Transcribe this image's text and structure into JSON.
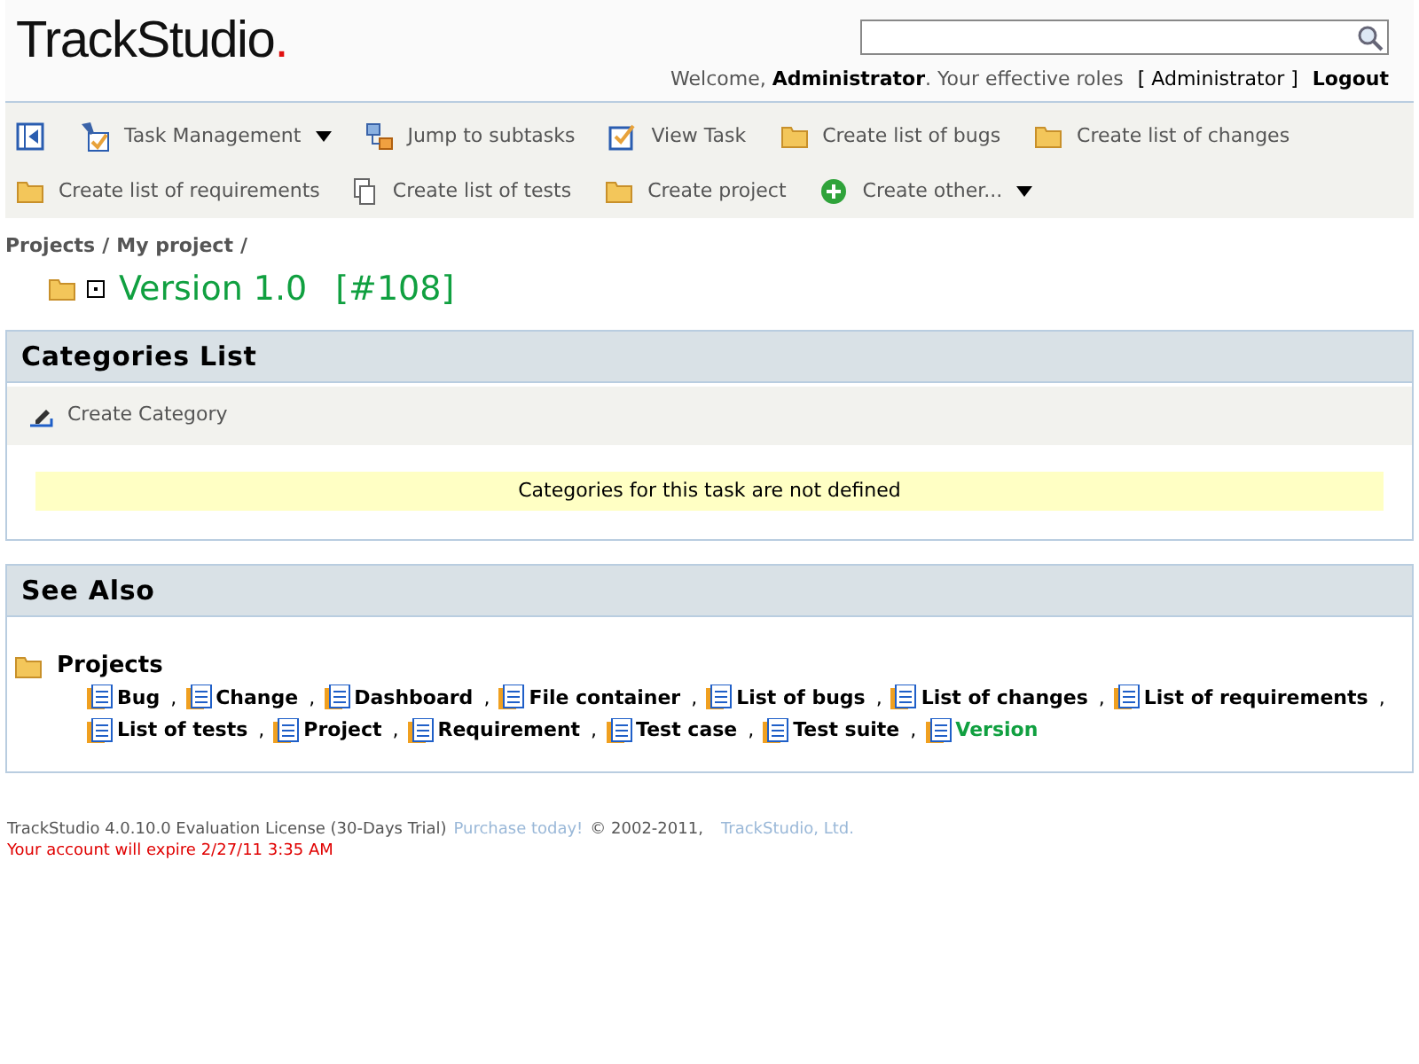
{
  "logo": {
    "text": "TrackStudio",
    "dot": "."
  },
  "user_bar": {
    "welcome": "Welcome,",
    "user": "Administrator",
    "roles_text": ". Your effective roles",
    "roles": "[ Administrator ]",
    "logout": "Logout"
  },
  "toolbar": [
    {
      "kind": "panel",
      "dropdown": false
    },
    {
      "kind": "tools",
      "label": "Task Management",
      "dropdown": true
    },
    {
      "kind": "subtasks",
      "label": "Jump to subtasks",
      "dropdown": false
    },
    {
      "kind": "check",
      "label": "View Task",
      "dropdown": false
    },
    {
      "kind": "folder",
      "label": "Create list of bugs",
      "dropdown": false
    },
    {
      "kind": "folder",
      "label": "Create list of changes",
      "dropdown": false
    },
    {
      "kind": "folder",
      "label": "Create list of requirements",
      "dropdown": false
    },
    {
      "kind": "copy",
      "label": "Create list of tests",
      "dropdown": false
    },
    {
      "kind": "folder",
      "label": "Create project",
      "dropdown": false
    },
    {
      "kind": "plus",
      "label": "Create other...",
      "dropdown": true
    }
  ],
  "breadcrumb": [
    {
      "label": "Projects",
      "sep": "/"
    },
    {
      "label": "My project",
      "sep": "/"
    }
  ],
  "task": {
    "title": "Version 1.0",
    "number": "[#108]"
  },
  "categories": {
    "title": "Categories List",
    "action": "Create Category",
    "notice": "Categories for this task are not defined"
  },
  "see_also": {
    "title": "See Also",
    "group": "Projects",
    "items": [
      {
        "label": "Bug",
        "suffix": ",",
        "current": false
      },
      {
        "label": "Change",
        "suffix": ",",
        "current": false
      },
      {
        "label": "Dashboard",
        "suffix": ",",
        "current": false
      },
      {
        "label": "File container",
        "suffix": ",",
        "current": false
      },
      {
        "label": "List of bugs",
        "suffix": ",",
        "current": false
      },
      {
        "label": "List of changes",
        "suffix": ",",
        "current": false
      },
      {
        "label": "List of requirements",
        "suffix": ",",
        "current": false
      },
      {
        "label": "List of tests",
        "suffix": ",",
        "current": false
      },
      {
        "label": "Project",
        "suffix": ",",
        "current": false
      },
      {
        "label": "Requirement",
        "suffix": ",",
        "current": false
      },
      {
        "label": "Test case",
        "suffix": ",",
        "current": false
      },
      {
        "label": "Test suite",
        "suffix": ",",
        "current": false
      },
      {
        "label": "Version",
        "current": true
      }
    ]
  },
  "footer": {
    "license": "TrackStudio 4.0.10.0 Evaluation License (30-Days Trial)",
    "purchase": "Purchase today!",
    "copyright": "© 2002-2011,",
    "company": "TrackStudio, Ltd.",
    "expire": "Your account will expire 2/27/11 3:35 AM"
  }
}
